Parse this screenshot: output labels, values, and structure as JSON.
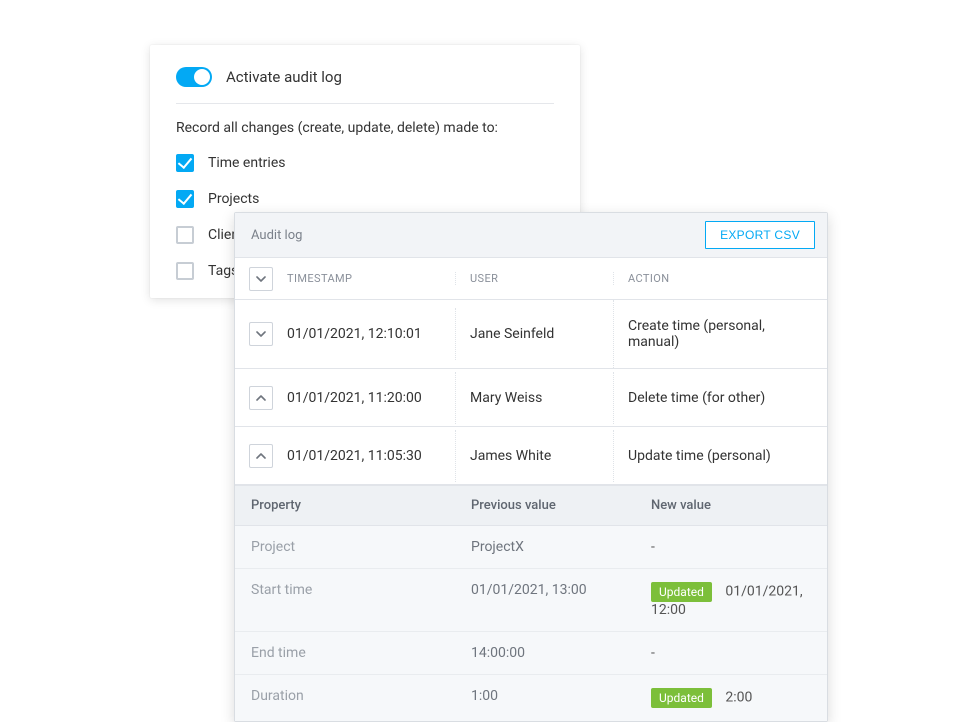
{
  "settings": {
    "toggle_label": "Activate audit log",
    "description": "Record all changes (create, update, delete) made to:",
    "options": [
      {
        "label": "Time entries",
        "checked": true
      },
      {
        "label": "Projects",
        "checked": true
      },
      {
        "label": "Clients",
        "checked": false
      },
      {
        "label": "Tags",
        "checked": false
      }
    ]
  },
  "audit": {
    "title": "Audit log",
    "export_label": "EXPORT CSV",
    "columns": {
      "timestamp": "TIMESTAMP",
      "user": "USER",
      "action": "ACTION"
    },
    "rows": [
      {
        "expand": "down",
        "ts": "01/01/2021, 12:10:01",
        "user": "Jane Seinfeld",
        "action": "Create time (personal, manual)"
      },
      {
        "expand": "up",
        "ts": "01/01/2021, 11:20:00",
        "user": "Mary Weiss",
        "action": "Delete time (for other)"
      },
      {
        "expand": "up",
        "ts": "01/01/2021, 11:05:30",
        "user": "James White",
        "action": "Update time (personal)"
      }
    ],
    "detail": {
      "headers": {
        "property": "Property",
        "prev": "Previous value",
        "new": "New value"
      },
      "rows": [
        {
          "property": "Project",
          "prev": "ProjectX",
          "badge": "",
          "new_val": "-"
        },
        {
          "property": "Start time",
          "prev": "01/01/2021, 13:00",
          "badge": "Updated",
          "new_val": "01/01/2021, 12:00"
        },
        {
          "property": "End time",
          "prev": "14:00:00",
          "badge": "",
          "new_val": "-"
        },
        {
          "property": "Duration",
          "prev": "1:00",
          "badge": "Updated",
          "new_val": "2:00"
        }
      ]
    }
  }
}
